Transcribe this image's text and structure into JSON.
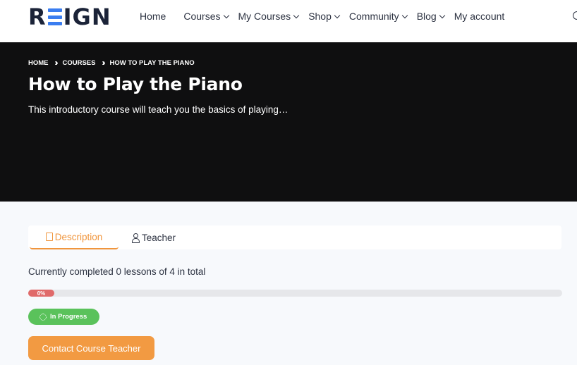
{
  "header": {
    "logo": "REIGN",
    "nav": [
      {
        "label": "Home",
        "dropdown": false
      },
      {
        "label": "Courses",
        "dropdown": true
      },
      {
        "label": "My Courses",
        "dropdown": true
      },
      {
        "label": "Shop",
        "dropdown": true
      },
      {
        "label": "Community",
        "dropdown": true
      },
      {
        "label": "Blog",
        "dropdown": true
      },
      {
        "label": "My account",
        "dropdown": false
      }
    ]
  },
  "hero": {
    "breadcrumb": [
      "HOME",
      "COURSES",
      "HOW TO PLAY THE PIANO"
    ],
    "title": "How to Play the Piano",
    "subtitle": "This introductory course will teach you the basics of playing…"
  },
  "tabs": [
    {
      "label": "Description",
      "icon": "document-icon",
      "active": true
    },
    {
      "label": "Teacher",
      "icon": "user-icon",
      "active": false
    }
  ],
  "progress": {
    "text": "Currently completed 0 lessons of 4 in total",
    "percent_label": "0%",
    "percent": 0
  },
  "status": {
    "label": "In Progress",
    "color": "#5ac25b"
  },
  "contact_button": {
    "label": "Contact Course Teacher"
  },
  "colors": {
    "accent": "#f0953c",
    "hero_bg": "#0f0f10",
    "progress": "#e06a6a",
    "logo_e": "#3a7df0"
  }
}
